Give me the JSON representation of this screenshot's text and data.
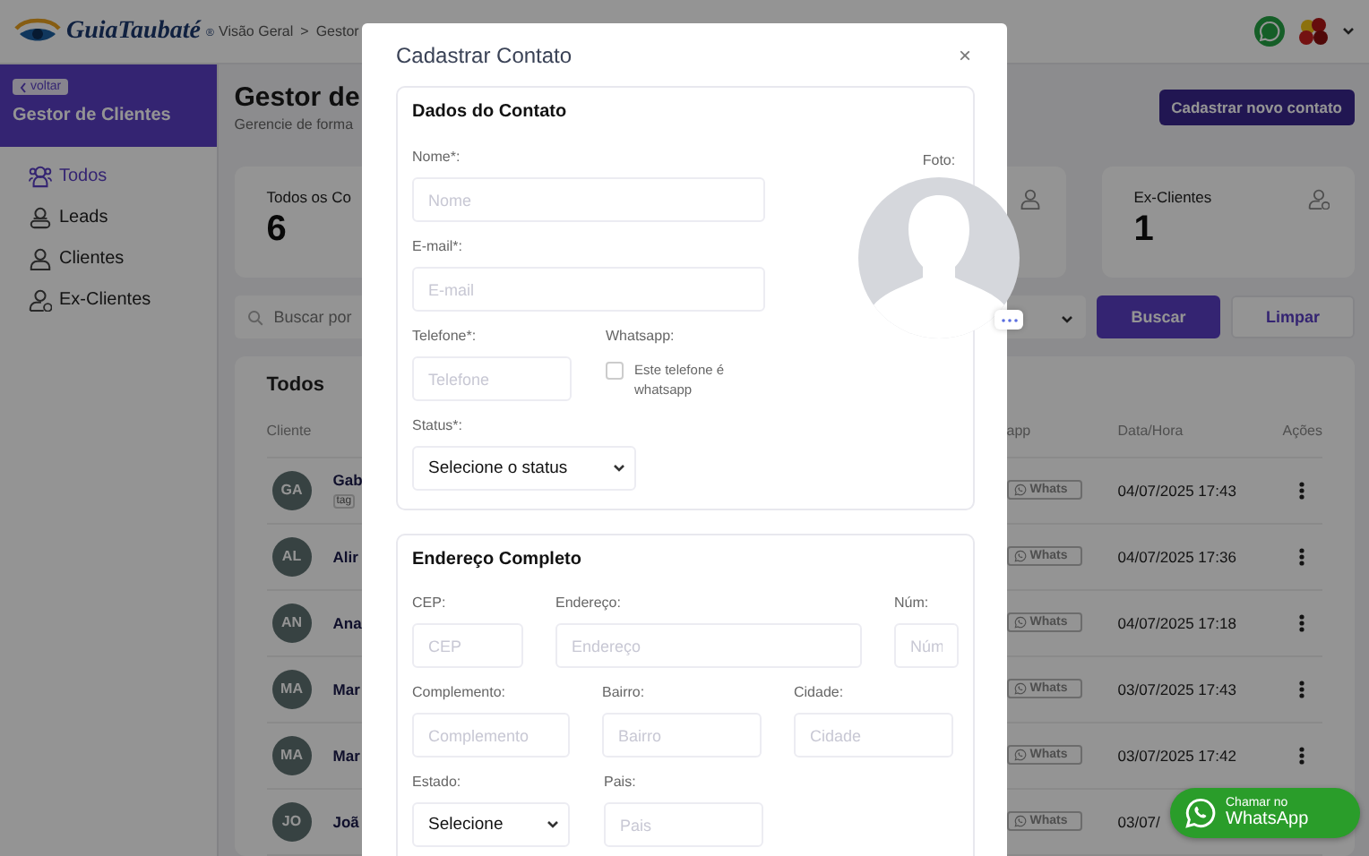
{
  "header": {
    "logo": "GuiaTaubaté",
    "logo_mark": "®",
    "breadcrumb": [
      "Visão Geral",
      ">",
      "Gestor"
    ]
  },
  "sidebar": {
    "back_button": "voltar",
    "title": "Gestor de Clientes",
    "items": [
      {
        "label": "Todos",
        "kind": "group",
        "selected": true
      },
      {
        "label": "Leads",
        "kind": "lead",
        "selected": false
      },
      {
        "label": "Clientes",
        "kind": "client",
        "selected": false
      },
      {
        "label": "Ex-Clientes",
        "kind": "ex_client",
        "selected": false
      }
    ]
  },
  "page": {
    "title": "Gestor de",
    "subtitle": "Gerencie de forma",
    "new_button": "Cadastrar novo contato"
  },
  "stats": [
    {
      "label": "Todos os Co",
      "value": "6"
    },
    {
      "kind": "client"
    },
    {
      "label": "Ex-Clientes",
      "value": "1",
      "kind": "ex_client"
    }
  ],
  "filters": {
    "search_placeholder": "Buscar por",
    "buttons": [
      {
        "label": "Buscar",
        "kind": "primary"
      },
      {
        "label": "Limpar",
        "kind": "secondary"
      }
    ]
  },
  "table": {
    "title": "Todos",
    "columns": [
      "Cliente",
      "app",
      "Data/Hora",
      "Ações"
    ],
    "rows": [
      {
        "initials": "GA",
        "name": "Gab",
        "tag": "tag",
        "whats": "Whats",
        "date": "04/07/2025 17:43"
      },
      {
        "initials": "AL",
        "name": "Alir",
        "whats": "Whats",
        "date": "04/07/2025 17:36"
      },
      {
        "initials": "AN",
        "name": "Ana",
        "whats": "Whats",
        "date": "04/07/2025 17:18"
      },
      {
        "initials": "MA",
        "name": "Mar",
        "whats": "Whats",
        "date": "03/07/2025 17:43"
      },
      {
        "initials": "MA",
        "name": "Mar",
        "whats": "Whats",
        "date": "03/07/2025 17:42"
      },
      {
        "initials": "JO",
        "name": "Joã",
        "whats": "Whats",
        "date": "03/07/"
      }
    ]
  },
  "whatsapp_float": {
    "line1": "Chamar no",
    "line2": "WhatsApp"
  },
  "modal": {
    "title": "Cadastrar Contato",
    "close": "×",
    "contact": {
      "title": "Dados do Contato",
      "name": {
        "label": "Nome*:",
        "placeholder": "Nome"
      },
      "email": {
        "label": "E-mail*:",
        "placeholder": "E-mail"
      },
      "phone": {
        "label": "Telefone*:",
        "placeholder": "Telefone"
      },
      "whatsapp": {
        "label": "Whatsapp:",
        "text": "Este telefone é whatsapp",
        "checked": false
      },
      "status": {
        "label": "Status*:",
        "value": "Selecione o status"
      },
      "photo": {
        "label": "Foto:"
      }
    },
    "address": {
      "title": "Endereço Completo",
      "rows": [
        [
          {
            "label": "CEP:",
            "placeholder": "CEP",
            "kind": "text"
          },
          {
            "label": "Endereço:",
            "placeholder": "Endereço",
            "kind": "text"
          },
          {
            "label": "Núm:",
            "placeholder": "Núm",
            "kind": "text"
          }
        ],
        [
          {
            "label": "Complemento:",
            "placeholder": "Complemento",
            "kind": "text"
          },
          {
            "label": "Bairro:",
            "placeholder": "Bairro",
            "kind": "text"
          },
          {
            "label": "Cidade:",
            "placeholder": "Cidade",
            "kind": "text"
          }
        ],
        [
          {
            "label": "Estado:",
            "value": "Selecione",
            "kind": "select"
          },
          {
            "label": "Pais:",
            "placeholder": "Pais",
            "kind": "text"
          }
        ]
      ]
    }
  }
}
